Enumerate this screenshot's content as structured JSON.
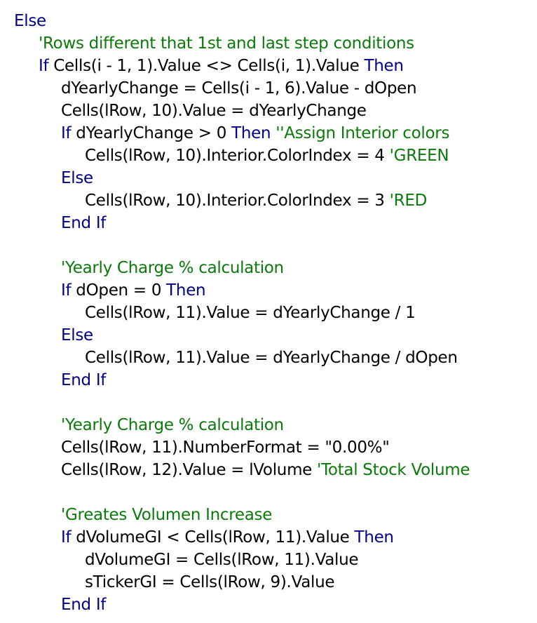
{
  "colors": {
    "keyword": "#00008b",
    "comment": "#0a7a0a",
    "text": "#000000",
    "background": "#ffffff"
  },
  "lines": [
    {
      "indent": 0,
      "tokens": [
        {
          "t": "kw",
          "v": "Else"
        }
      ]
    },
    {
      "indent": 1,
      "tokens": [
        {
          "t": "cm",
          "v": "'Rows different that 1st and last step conditions"
        }
      ]
    },
    {
      "indent": 1,
      "tokens": [
        {
          "t": "kw",
          "v": "If"
        },
        {
          "t": "tx",
          "v": " Cells(i - 1, 1).Value <> Cells(i, 1).Value "
        },
        {
          "t": "kw",
          "v": "Then"
        }
      ]
    },
    {
      "indent": 2,
      "tokens": [
        {
          "t": "tx",
          "v": "dYearlyChange = Cells(i - 1, 6).Value - dOpen"
        }
      ]
    },
    {
      "indent": 2,
      "tokens": [
        {
          "t": "tx",
          "v": "Cells(lRow, 10).Value = dYearlyChange"
        }
      ]
    },
    {
      "indent": 2,
      "tokens": [
        {
          "t": "kw",
          "v": "If"
        },
        {
          "t": "tx",
          "v": " dYearlyChange > 0 "
        },
        {
          "t": "kw",
          "v": "Then"
        },
        {
          "t": "tx",
          "v": " "
        },
        {
          "t": "cm",
          "v": "''Assign Interior colors"
        }
      ]
    },
    {
      "indent": 3,
      "tokens": [
        {
          "t": "tx",
          "v": "Cells(lRow, 10).Interior.ColorIndex = 4 "
        },
        {
          "t": "cm",
          "v": "'GREEN"
        }
      ]
    },
    {
      "indent": 2,
      "tokens": [
        {
          "t": "kw",
          "v": "Else"
        }
      ]
    },
    {
      "indent": 3,
      "tokens": [
        {
          "t": "tx",
          "v": "Cells(lRow, 10).Interior.ColorIndex = 3 "
        },
        {
          "t": "cm",
          "v": "'RED"
        }
      ]
    },
    {
      "indent": 2,
      "tokens": [
        {
          "t": "kw",
          "v": "End If"
        }
      ]
    },
    {
      "indent": 0,
      "tokens": []
    },
    {
      "indent": 2,
      "tokens": [
        {
          "t": "cm",
          "v": "'Yearly Charge % calculation"
        }
      ]
    },
    {
      "indent": 2,
      "tokens": [
        {
          "t": "kw",
          "v": "If"
        },
        {
          "t": "tx",
          "v": " dOpen = 0 "
        },
        {
          "t": "kw",
          "v": "Then"
        }
      ]
    },
    {
      "indent": 3,
      "tokens": [
        {
          "t": "tx",
          "v": "Cells(lRow, 11).Value = dYearlyChange / 1"
        }
      ]
    },
    {
      "indent": 2,
      "tokens": [
        {
          "t": "kw",
          "v": "Else"
        }
      ]
    },
    {
      "indent": 3,
      "tokens": [
        {
          "t": "tx",
          "v": "Cells(lRow, 11).Value = dYearlyChange / dOpen"
        }
      ]
    },
    {
      "indent": 2,
      "tokens": [
        {
          "t": "kw",
          "v": "End If"
        }
      ]
    },
    {
      "indent": 0,
      "tokens": []
    },
    {
      "indent": 2,
      "tokens": [
        {
          "t": "cm",
          "v": "'Yearly Charge % calculation"
        }
      ]
    },
    {
      "indent": 2,
      "tokens": [
        {
          "t": "tx",
          "v": "Cells(lRow, 11).NumberFormat = \"0.00%\""
        }
      ]
    },
    {
      "indent": 2,
      "tokens": [
        {
          "t": "tx",
          "v": "Cells(lRow, 12).Value = lVolume "
        },
        {
          "t": "cm",
          "v": "'Total Stock Volume"
        }
      ]
    },
    {
      "indent": 0,
      "tokens": []
    },
    {
      "indent": 2,
      "tokens": [
        {
          "t": "cm",
          "v": "'Greates Volumen Increase"
        }
      ]
    },
    {
      "indent": 2,
      "tokens": [
        {
          "t": "kw",
          "v": "If"
        },
        {
          "t": "tx",
          "v": " dVolumeGI < Cells(lRow, 11).Value "
        },
        {
          "t": "kw",
          "v": "Then"
        }
      ]
    },
    {
      "indent": 3,
      "tokens": [
        {
          "t": "tx",
          "v": "dVolumeGI = Cells(lRow, 11).Value"
        }
      ]
    },
    {
      "indent": 3,
      "tokens": [
        {
          "t": "tx",
          "v": "sTickerGI = Cells(lRow, 9).Value"
        }
      ]
    },
    {
      "indent": 2,
      "tokens": [
        {
          "t": "kw",
          "v": "End If"
        }
      ]
    }
  ]
}
